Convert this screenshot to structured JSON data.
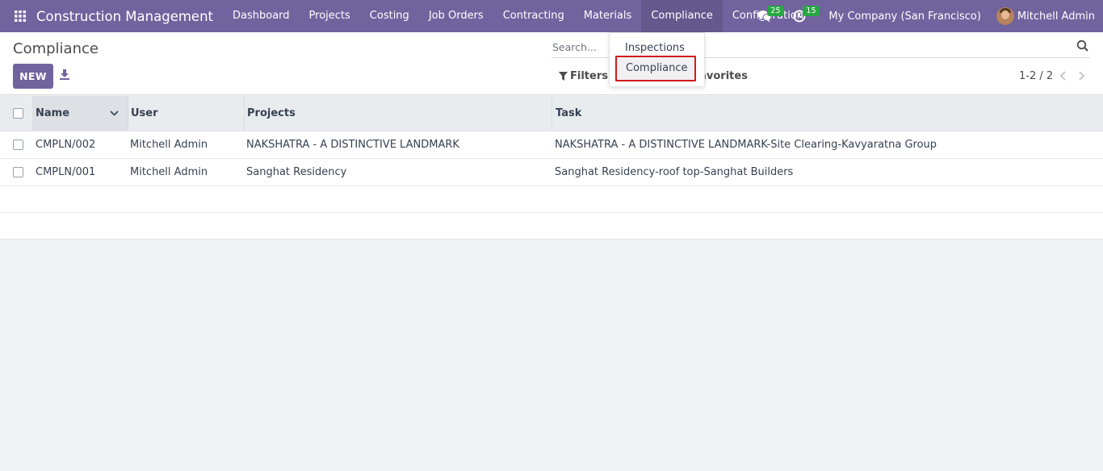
{
  "navbar": {
    "brand": "Construction Management",
    "menu": [
      "Dashboard",
      "Projects",
      "Costing",
      "Job Orders",
      "Contracting",
      "Materials",
      "Compliance",
      "Configuration"
    ],
    "active_menu": "Compliance",
    "messages_count": "25",
    "activities_count": "15",
    "company": "My Company (San Francisco)",
    "user": "Mitchell Admin",
    "accent_color": "#71639e"
  },
  "dropdown": {
    "items": [
      "Inspections",
      "Compliance"
    ],
    "highlighted": "Compliance",
    "highlight_color": "#d21b1b"
  },
  "control_panel": {
    "title": "Compliance",
    "new_label": "NEW",
    "search_placeholder": "Search...",
    "filters_label": "Filters",
    "favorites_label": "Favorites",
    "pager": "1-2 / 2"
  },
  "table": {
    "columns": [
      "Name",
      "User",
      "Projects",
      "Task"
    ],
    "rows": [
      {
        "name": "CMPLN/002",
        "user": "Mitchell Admin",
        "projects": "NAKSHATRA - A DISTINCTIVE LANDMARK",
        "task": "NAKSHATRA - A DISTINCTIVE LANDMARK-Site Clearing-Kavyaratna Group"
      },
      {
        "name": "CMPLN/001",
        "user": "Mitchell Admin",
        "projects": "Sanghat Residency",
        "task": "Sanghat Residency-roof top-Sanghat Builders"
      }
    ]
  }
}
